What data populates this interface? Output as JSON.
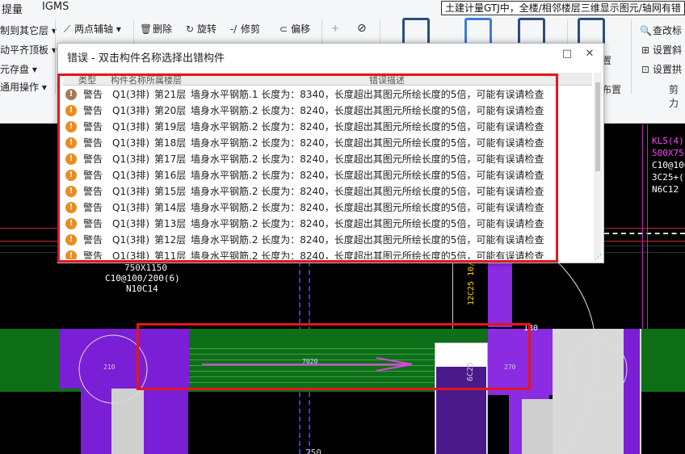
{
  "ribbon": {
    "tabs": [
      "提量",
      "IGMS"
    ],
    "hint": "土建计量GTJ中，全楼/相邻楼层三维显示图元/轴网有错",
    "left_items": [
      "制到其它层",
      "动平齐顶板",
      "元存盘",
      "通用操作"
    ],
    "tools": {
      "two_point_axis": "两点辅轴",
      "delete": "删除",
      "rotate": "旋转",
      "trim": "修剪",
      "offset": "偏移"
    },
    "right_items": [
      "查改标",
      "设置斜",
      "设置拱"
    ],
    "group_labels": [
      "置",
      "布置",
      "剪力"
    ]
  },
  "dialog": {
    "title": "错误 - 双击构件名称选择出错构件",
    "controls": {
      "maximize": "□",
      "close": "✕"
    },
    "columns": [
      "类型",
      "构件名称",
      "所属楼层",
      "错误描述"
    ],
    "rows": [
      {
        "type": "警告",
        "component": "Q1(3排)",
        "floor": "第21层",
        "description": "墙身水平钢筋.1 长度为：8340，长度超出其图元所绘长度的5倍，可能有误请检查"
      },
      {
        "type": "警告",
        "component": "Q1(3排)",
        "floor": "第20层",
        "description": "墙身水平钢筋.2 长度为：8240，长度超出其图元所绘长度的5倍，可能有误请检查"
      },
      {
        "type": "警告",
        "component": "Q1(3排)",
        "floor": "第19层",
        "description": "墙身水平钢筋.2 长度为：8240，长度超出其图元所绘长度的5倍，可能有误请检查"
      },
      {
        "type": "警告",
        "component": "Q1(3排)",
        "floor": "第18层",
        "description": "墙身水平钢筋.2 长度为：8240，长度超出其图元所绘长度的5倍，可能有误请检查"
      },
      {
        "type": "警告",
        "component": "Q1(3排)",
        "floor": "第17层",
        "description": "墙身水平钢筋.2 长度为：8240，长度超出其图元所绘长度的5倍，可能有误请检查"
      },
      {
        "type": "警告",
        "component": "Q1(3排)",
        "floor": "第16层",
        "description": "墙身水平钢筋.2 长度为：8240，长度超出其图元所绘长度的5倍，可能有误请检查"
      },
      {
        "type": "警告",
        "component": "Q1(3排)",
        "floor": "第15层",
        "description": "墙身水平钢筋.2 长度为：8240，长度超出其图元所绘长度的5倍，可能有误请检查"
      },
      {
        "type": "警告",
        "component": "Q1(3排)",
        "floor": "第14层",
        "description": "墙身水平钢筋.2 长度为：8240，长度超出其图元所绘长度的5倍，可能有误请检查"
      },
      {
        "type": "警告",
        "component": "Q1(3排)",
        "floor": "第13层",
        "description": "墙身水平钢筋.2 长度为：8240，长度超出其图元所绘长度的5倍，可能有误请检查"
      },
      {
        "type": "警告",
        "component": "Q1(3排)",
        "floor": "第12层",
        "description": "墙身水平钢筋.2 长度为：8240，长度超出其图元所绘长度的5倍，可能有误请检查"
      },
      {
        "type": "警告",
        "component": "Q1(3排)",
        "floor": "第11层",
        "description": "墙身水平钢筋.2 长度为：8240，长度超出其图元所绘长度的5倍，可能有误请检查"
      }
    ]
  },
  "canvas": {
    "beam_label_right": [
      "KL5(4)",
      "500X75",
      "C10@100",
      "3C25+(",
      "N6C12"
    ],
    "beam_label_left": [
      "750X1150",
      "C10@100/200(6)",
      "N10C14"
    ],
    "vertical_label": "12C25 10/2",
    "wall_dim": "7020",
    "side_mark": "6C25",
    "bottom_text": "250",
    "marker_180": "180",
    "small_left": "210",
    "small_right": "270"
  },
  "colors": {
    "warning": "#f08a1c",
    "highlight": "#e3161b",
    "cad_purple": "#7a1fd6",
    "cad_green": "#0f7a1c",
    "cad_magenta": "#ff33ff"
  }
}
